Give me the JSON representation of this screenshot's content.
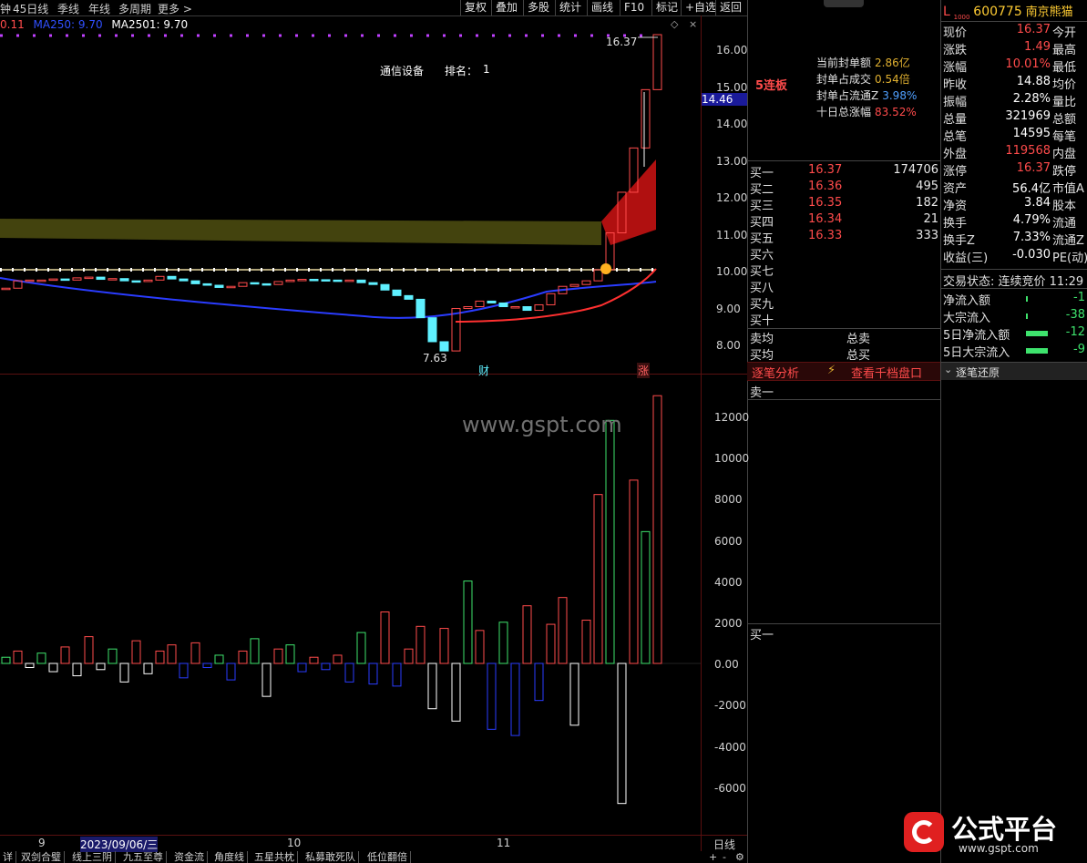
{
  "toolbar": {
    "left_items": [
      "钟",
      "45日线",
      "季线",
      "年线",
      "多周期",
      "更多 >"
    ],
    "buttons": [
      "复权",
      "叠加",
      "多股",
      "统计",
      "画线",
      "F10",
      "标记",
      "+自选",
      "返回"
    ]
  },
  "ma_legend": {
    "item1": "0.11",
    "item2": "MA250: 9.70",
    "item3": "MA2501: 9.70"
  },
  "industry": {
    "name": "通信设备",
    "rank_label": "排名：",
    "rank": "1"
  },
  "chart_annotations": {
    "high": "16.37",
    "low": "7.63",
    "cai": "财",
    "zhang": "涨",
    "current_tag": "14.46",
    "lianban": "5连板"
  },
  "seal_info": {
    "rows": [
      {
        "label": "当前封单额",
        "value": "2.86亿"
      },
      {
        "label": "封单占成交",
        "value": "0.54倍"
      },
      {
        "label": "封单占流通Z",
        "value": "3.98%"
      },
      {
        "label": "十日总涨幅",
        "value": "83.52%"
      }
    ]
  },
  "price_axis": [
    "16.00",
    "15.00",
    "14.00",
    "13.00",
    "12.00",
    "11.00",
    "10.00",
    "9.00",
    "8.00"
  ],
  "volume_axis": [
    "12000",
    "10000",
    "8000",
    "6000",
    "4000",
    "2000",
    "0.00",
    "-2000",
    "-4000",
    "-6000"
  ],
  "time_axis": {
    "t1": "9",
    "t2": "2023/09/06/三",
    "t3": "10",
    "t4": "11",
    "period": "日线"
  },
  "bottom_tabs": [
    "详",
    "双剑合璧",
    "线上三阴",
    "九五至尊",
    "资金流",
    "角度线",
    "五星共枕",
    "私募敢死队",
    "低位翻倍"
  ],
  "bottom_controls": {
    "plus": "+",
    "minus": "-",
    "gear": "⚙"
  },
  "stock": {
    "market": "L",
    "badge": "1000",
    "code": "600775",
    "name": "南京熊猫"
  },
  "quote": [
    {
      "l": "现价",
      "v": "16.37",
      "vc": "red",
      "r": "今开"
    },
    {
      "l": "涨跌",
      "v": "1.49",
      "vc": "red",
      "r": "最高"
    },
    {
      "l": "涨幅",
      "v": "10.01%",
      "vc": "red",
      "r": "最低"
    },
    {
      "l": "昨收",
      "v": "14.88",
      "vc": "white",
      "r": "均价"
    },
    {
      "l": "振幅",
      "v": "2.28%",
      "vc": "white",
      "r": "量比"
    },
    {
      "l": "总量",
      "v": "321969",
      "vc": "white",
      "r": "总额"
    },
    {
      "l": "总笔",
      "v": "14595",
      "vc": "white",
      "r": "每笔"
    },
    {
      "l": "外盘",
      "v": "119568",
      "vc": "red",
      "r": "内盘"
    },
    {
      "l": "涨停",
      "v": "16.37",
      "vc": "red",
      "r": "跌停"
    },
    {
      "l": "资产",
      "v": "56.4亿",
      "vc": "white",
      "r": "市值A"
    },
    {
      "l": "净资",
      "v": "3.84",
      "vc": "white",
      "r": "股本"
    },
    {
      "l": "换手",
      "v": "4.79%",
      "vc": "white",
      "r": "流通"
    },
    {
      "l": "换手Z",
      "v": "7.33%",
      "vc": "white",
      "r": "流通Z"
    },
    {
      "l": "收益(三)",
      "v": "-0.030",
      "vc": "white",
      "r": "PE(动)"
    }
  ],
  "trade_status": {
    "label": "交易状态:",
    "value": "连续竞价 11:29"
  },
  "flows": [
    {
      "label": "净流入额",
      "value": "-1"
    },
    {
      "label": "大宗流入",
      "value": "-38"
    },
    {
      "label": "5日净流入额",
      "value": "-12"
    },
    {
      "label": "5日大宗流入",
      "value": "-9"
    }
  ],
  "order_book": {
    "buy": [
      {
        "l": "买一",
        "p": "16.37",
        "v": "174706"
      },
      {
        "l": "买二",
        "p": "16.36",
        "v": "495"
      },
      {
        "l": "买三",
        "p": "16.35",
        "v": "182"
      },
      {
        "l": "买四",
        "p": "16.34",
        "v": "21"
      },
      {
        "l": "买五",
        "p": "16.33",
        "v": "333"
      },
      {
        "l": "买六",
        "p": "",
        "v": ""
      },
      {
        "l": "买七",
        "p": "",
        "v": ""
      },
      {
        "l": "买八",
        "p": "",
        "v": ""
      },
      {
        "l": "买九",
        "p": "",
        "v": ""
      },
      {
        "l": "买十",
        "p": "",
        "v": ""
      }
    ],
    "avg_sell": "卖均",
    "total_sell": "总卖",
    "avg_buy": "买均",
    "total_buy": "总买"
  },
  "tick_panel": {
    "analysis": "逐笔分析",
    "view_depth": "查看千档盘口",
    "restore": "逐笔还原",
    "sell1": "卖一",
    "buy1": "买一"
  },
  "watermark": "www.gspt.com",
  "logo": {
    "cn": "公式平台",
    "url": "www.gspt.com"
  },
  "colors": {
    "up": "#ff4b4b",
    "down": "#3ee36d",
    "cyan": "#5ff0ff",
    "panel_line": "#5a1010"
  }
}
